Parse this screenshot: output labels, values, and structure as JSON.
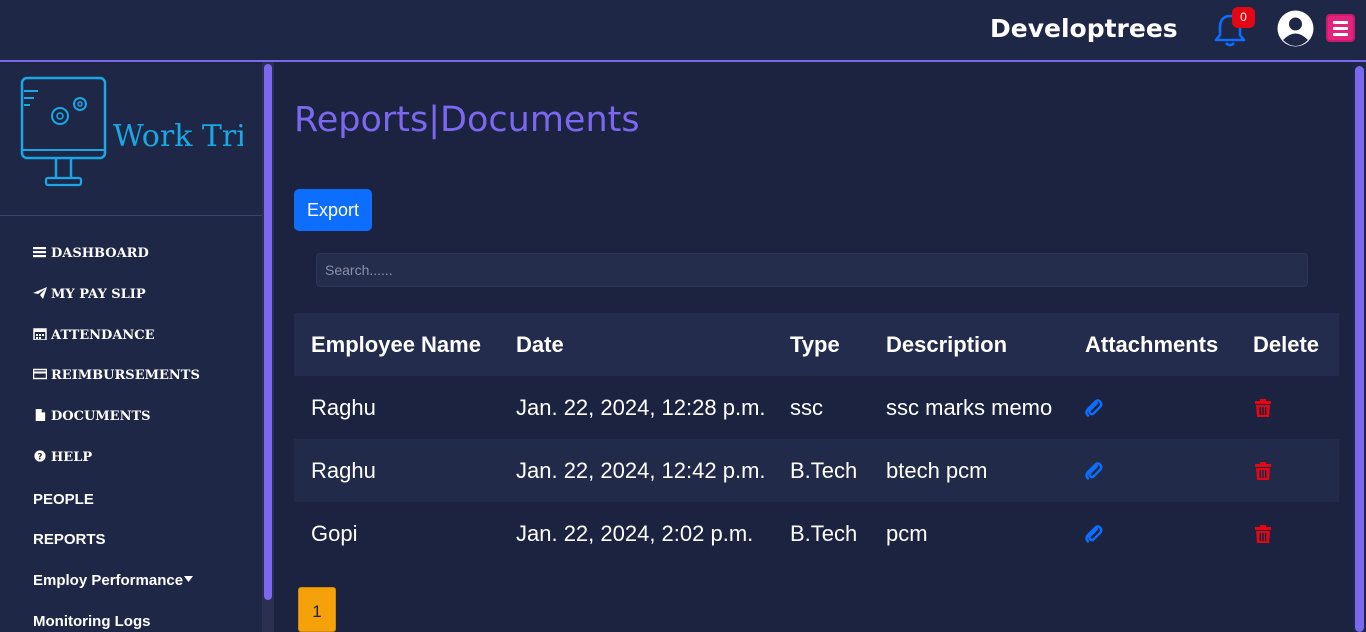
{
  "header": {
    "brand": "Developtrees",
    "notification_count": "0"
  },
  "logo": {
    "text": "Work Tried"
  },
  "sidebar": {
    "items": [
      {
        "label": "DASHBOARD",
        "icon": "bars-icon"
      },
      {
        "label": "MY PAY SLIP",
        "icon": "paper-plane-icon"
      },
      {
        "label": "ATTENDANCE",
        "icon": "calendar-icon"
      },
      {
        "label": "REIMBURSEMENTS",
        "icon": "credit-card-icon"
      },
      {
        "label": "DOCUMENTS",
        "icon": "file-icon"
      },
      {
        "label": "HELP",
        "icon": "question-circle-icon"
      },
      {
        "label": "PEOPLE"
      },
      {
        "label": "REPORTS"
      },
      {
        "label": "Employ Performance"
      },
      {
        "label": "Monitoring Logs"
      }
    ]
  },
  "main": {
    "title": "Reports|Documents",
    "export_label": "Export",
    "search_placeholder": "Search......",
    "columns": [
      "Employee Name",
      "Date",
      "Type",
      "Description",
      "Attachments",
      "Delete"
    ],
    "rows": [
      {
        "name": "Raghu",
        "date": "Jan. 22, 2024, 12:28 p.m.",
        "type": "ssc",
        "description": "ssc marks memo"
      },
      {
        "name": "Raghu",
        "date": "Jan. 22, 2024, 12:42 p.m.",
        "type": "B.Tech",
        "description": "btech pcm"
      },
      {
        "name": "Gopi",
        "date": "Jan. 22, 2024, 2:02 p.m.",
        "type": "B.Tech",
        "description": "pcm"
      }
    ],
    "page": "1"
  },
  "colors": {
    "accent": "#7b68ee",
    "primary": "#0d6efd",
    "danger": "#e30613",
    "pagination": "#f5a20a",
    "background": "#1c2340"
  }
}
